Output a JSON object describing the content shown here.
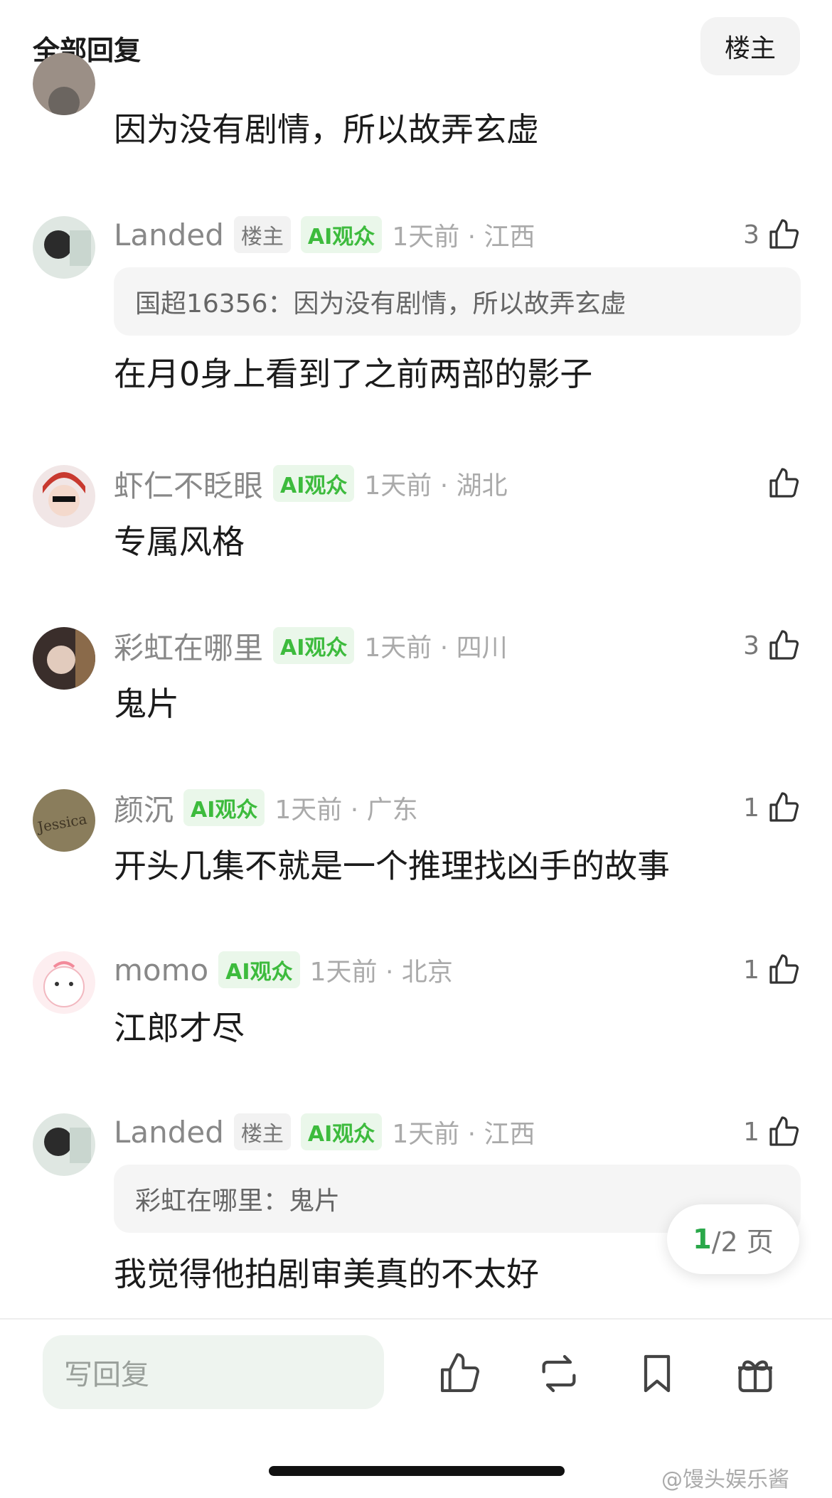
{
  "header": {
    "title": "全部回复",
    "filter_label": "楼主"
  },
  "first_comment": {
    "content": "因为没有剧情，所以故弄玄虚"
  },
  "comments": [
    {
      "user": "Landed",
      "owner_tag": "楼主",
      "ai_tag": "AI观众",
      "time": "1天前 · 江西",
      "likes": "3",
      "quote": "国超16356：因为没有剧情，所以故弄玄虚",
      "content": "在月0身上看到了之前两部的影子"
    },
    {
      "user": "虾仁不眨眼",
      "ai_tag": "AI观众",
      "time": "1天前 · 湖北",
      "likes": "",
      "content": "专属风格"
    },
    {
      "user": "彩虹在哪里",
      "ai_tag": "AI观众",
      "time": "1天前 · 四川",
      "likes": "3",
      "content": "鬼片"
    },
    {
      "user": "颜沉",
      "ai_tag": "AI观众",
      "time": "1天前 · 广东",
      "likes": "1",
      "content": "开头几集不就是一个推理找凶手的故事"
    },
    {
      "user": "momo",
      "ai_tag": "AI观众",
      "time": "1天前 · 北京",
      "likes": "1",
      "content": "江郎才尽"
    },
    {
      "user": "Landed",
      "owner_tag": "楼主",
      "ai_tag": "AI观众",
      "time": "1天前 · 江西",
      "likes": "1",
      "quote": "彩虹在哪里：鬼片",
      "content": "我觉得他拍剧审美真的不太好"
    }
  ],
  "pagination": {
    "current": "1",
    "total": "/2 页"
  },
  "bottom_bar": {
    "reply_placeholder": "写回复",
    "icons": [
      "thumb-up-icon",
      "repost-icon",
      "bookmark-icon",
      "gift-icon"
    ]
  },
  "watermark": "@馒头娱乐酱",
  "colors": {
    "accent_green": "#2aa84a",
    "ai_tag_green": "#3dbb3d"
  }
}
